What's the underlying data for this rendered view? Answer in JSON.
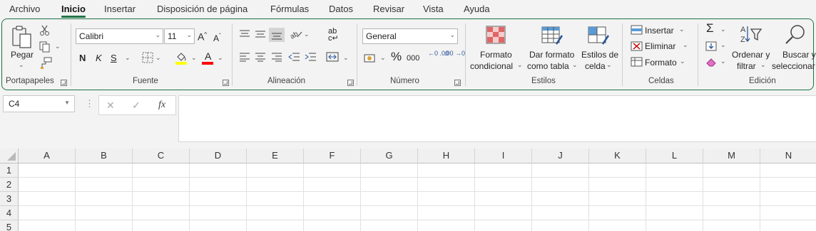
{
  "menu": {
    "tabs": [
      "Archivo",
      "Inicio",
      "Insertar",
      "Disposición de página",
      "Fórmulas",
      "Datos",
      "Revisar",
      "Vista",
      "Ayuda"
    ],
    "active": "Inicio"
  },
  "ribbon": {
    "portapapeles": {
      "label": "Portapapeles",
      "paste": "Pegar"
    },
    "fuente": {
      "label": "Fuente",
      "font_name": "Calibri",
      "font_size": "11",
      "bold": "N",
      "italic": "K",
      "underline": "S",
      "grow": "A",
      "shrink": "A",
      "font_color_glyph": "A",
      "fill_color": "#ffff00",
      "font_color": "#ff0000"
    },
    "alineacion": {
      "label": "Alineación",
      "wrap_glyph": "ab"
    },
    "numero": {
      "label": "Número",
      "format": "General",
      "percent": "%",
      "thousands": "000",
      "inc_dec": "←0 .00",
      "dec_dec": ".00 →0"
    },
    "estilos": {
      "label": "Estilos",
      "conditional_1": "Formato",
      "conditional_2": "condicional",
      "table_1": "Dar formato",
      "table_2": "como tabla",
      "cell_1": "Estilos de",
      "cell_2": "celda"
    },
    "celdas": {
      "label": "Celdas",
      "insert": "Insertar",
      "delete": "Eliminar",
      "format": "Formato"
    },
    "edicion": {
      "label": "Edición",
      "sort_1": "Ordenar y",
      "sort_2": "filtrar",
      "find_1": "Buscar y",
      "find_2": "seleccionar"
    }
  },
  "formula_bar": {
    "name_box": "C4",
    "cancel_glyph": "✕",
    "enter_glyph": "✓",
    "fx_glyph": "fx"
  },
  "sheet": {
    "columns": [
      "A",
      "B",
      "C",
      "D",
      "E",
      "F",
      "G",
      "H",
      "I",
      "J",
      "K",
      "L",
      "M",
      "N"
    ],
    "rows": [
      "1",
      "2",
      "3",
      "4",
      "5"
    ]
  },
  "colors": {
    "accent": "#217346",
    "ribbon_border": "#1e7145"
  }
}
